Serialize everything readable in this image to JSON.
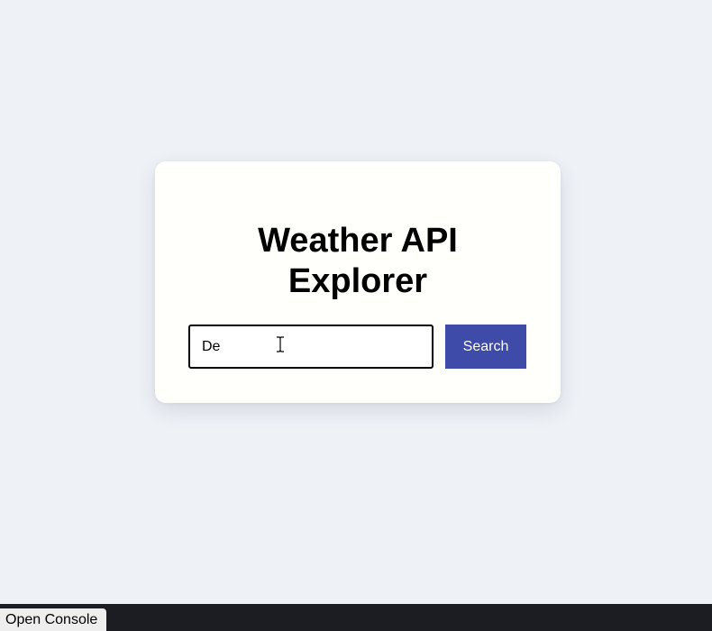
{
  "card": {
    "title_line1": "Weather API",
    "title_line2": "Explorer"
  },
  "search": {
    "input_value": "De",
    "button_label": "Search"
  },
  "console": {
    "button_label": "Open Console"
  },
  "colors": {
    "page_background": "#eef1f6",
    "card_background": "#fffffc",
    "button_accent": "#3f4ba8",
    "bottom_bar": "#1b1d22"
  },
  "icons": {
    "cursor": "text-cursor-icon"
  }
}
